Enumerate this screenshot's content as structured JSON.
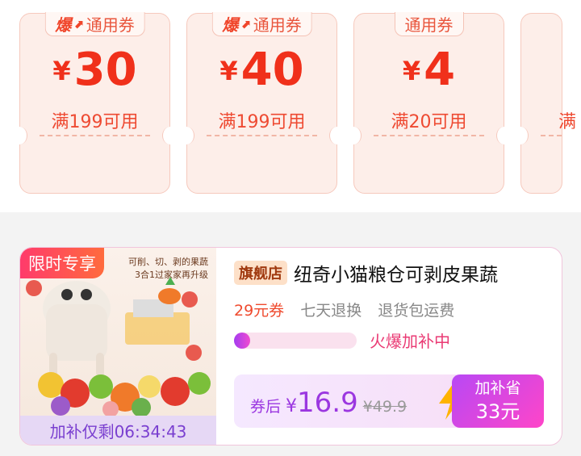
{
  "coupons": [
    {
      "hot": "爆",
      "tag": "通用券",
      "currency": "¥",
      "amount": "30",
      "condition": "满199可用"
    },
    {
      "hot": "爆",
      "tag": "通用券",
      "currency": "¥",
      "amount": "40",
      "condition": "满199可用"
    },
    {
      "hot": "",
      "tag": "通用券",
      "currency": "¥",
      "amount": "4",
      "condition": "满20可用"
    },
    {
      "hot": "",
      "tag": "",
      "currency": "",
      "amount": "",
      "condition": "满"
    }
  ],
  "product": {
    "limit_tag": "限时专享",
    "image_caption_1": "可削、切、剥的果蔬",
    "image_caption_2": "3合1过家家再升级",
    "countdown_label": "加补仅剩06:34:43",
    "store_flag": "旗舰店",
    "title": "纽奇小猫粮仓可剥皮果蔬",
    "coupon_note": "29元券",
    "return_note": "七天退换",
    "shipping_note": "退货包运费",
    "progress_fraction": 0.08,
    "progress_label": "火爆加补中",
    "price_prefix": "券后",
    "currency": "¥",
    "price": "16.9",
    "original_price": "¥49.9",
    "subsidy_label": "加补省",
    "subsidy_value": "33元"
  },
  "colors": {
    "accent": "#f0301b",
    "purple": "#9b37e0"
  }
}
